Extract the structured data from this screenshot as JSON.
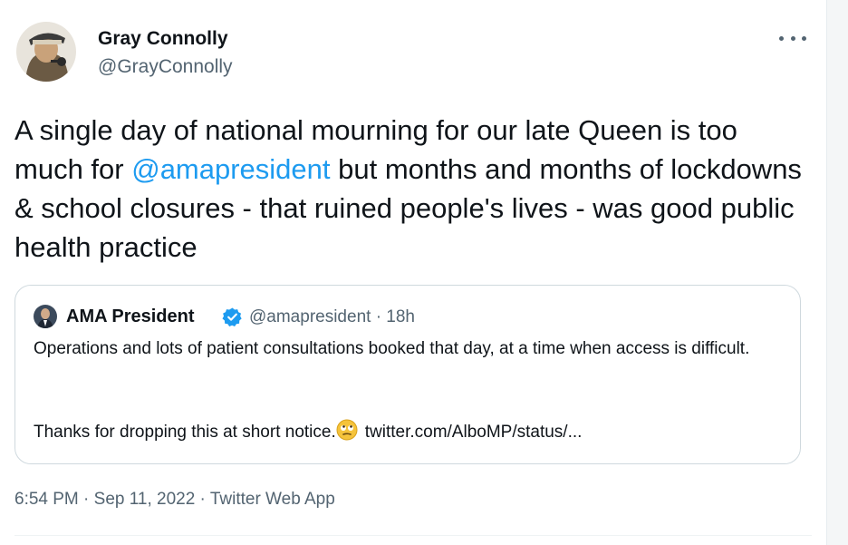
{
  "tweet": {
    "author_name": "Gray Connolly",
    "author_handle": "@GrayConnolly",
    "text_before": "A single day of national mourning for our late Queen is too much for ",
    "mention": "@amapresident",
    "text_after": " but months and months of lockdowns & school closures - that ruined people's lives - was good public health practice",
    "timestamp": "6:54 PM · Sep 11, 2022 · Twitter Web App",
    "more_icon": "more-horizontal-icon",
    "mention_color": "#1d9bf0"
  },
  "quote": {
    "author_name": "AMA President",
    "verified_icon": "verified-badge-icon",
    "author_handle": "@amapresident · 18h",
    "text_line1": "Operations and lots of patient consultations booked that day, at a time when access is difficult.",
    "text_line2": "Thanks for dropping this at short notice.",
    "emoji_icon": "face-with-rolling-eyes-icon",
    "link_text": "twitter.com/AlboMP/status/..."
  }
}
